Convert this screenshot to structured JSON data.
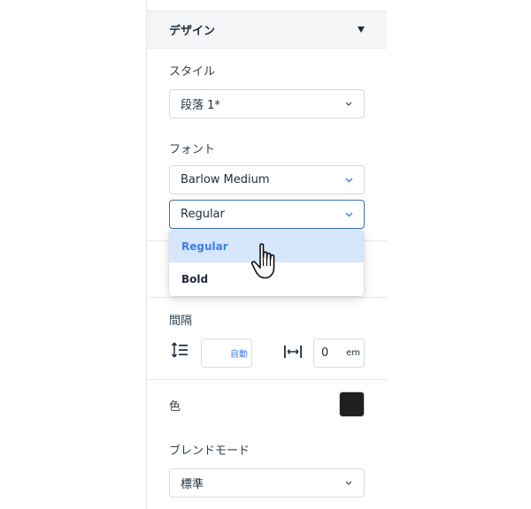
{
  "design_section": {
    "title": "デザイン",
    "toggle_icon": "caret-down-icon"
  },
  "style": {
    "label": "スタイル",
    "value": "段落 1*"
  },
  "font": {
    "label": "フォント",
    "family": "Barlow Medium",
    "weight": "Regular",
    "weight_options": [
      {
        "label": "Regular",
        "selected": true
      },
      {
        "label": "Bold",
        "selected": false
      }
    ]
  },
  "spacing": {
    "label": "間隔",
    "line_height": {
      "icon": "line-height-icon",
      "value": "自動"
    },
    "letter_spacing": {
      "icon": "letter-spacing-icon",
      "value": "0",
      "unit": "em"
    }
  },
  "color": {
    "label": "色",
    "value": "#1f1f1f"
  },
  "blend_mode": {
    "label": "ブレンドモード",
    "value": "標準"
  },
  "colors": {
    "accent": "#3d7ee6",
    "selected_bg": "#d6e6fc",
    "focus_border": "#3b6fb4"
  }
}
